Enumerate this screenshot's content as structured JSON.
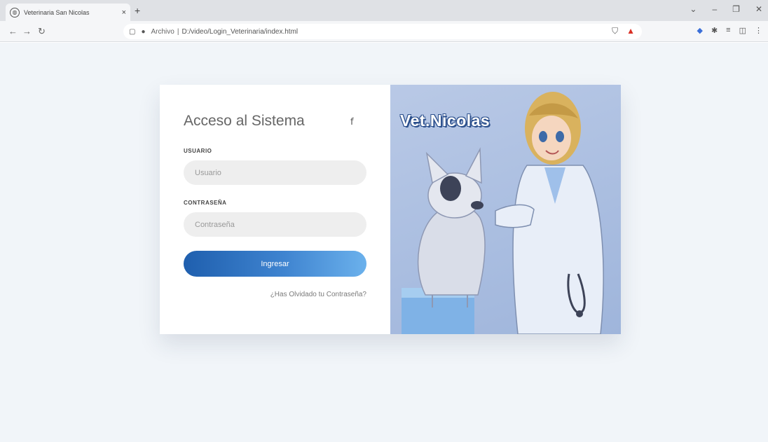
{
  "browser": {
    "tab_title": "Veterinaria San Nicolas",
    "tab_close": "×",
    "new_tab": "+",
    "address_chip": "Archivo",
    "address_url": "D:/video/Login_Veterinaria/index.html",
    "window_controls": [
      "⌄",
      "–",
      "❐",
      "✕"
    ]
  },
  "login": {
    "title": "Acceso al Sistema",
    "facebook_icon": "f",
    "user_label": "USUARIO",
    "user_placeholder": "Usuario",
    "password_label": "CONTRASEÑA",
    "password_placeholder": "Contraseña",
    "submit_label": "Ingresar",
    "forgot_link": "¿Has Olvidado tu Contraseña?"
  },
  "brand": {
    "name": "Vet.Nicolas"
  },
  "colors": {
    "page_bg": "#f1f5f9",
    "button_start": "#1f5fae",
    "button_end": "#6bb1ec",
    "illustration_bg": "#a9bde0"
  }
}
